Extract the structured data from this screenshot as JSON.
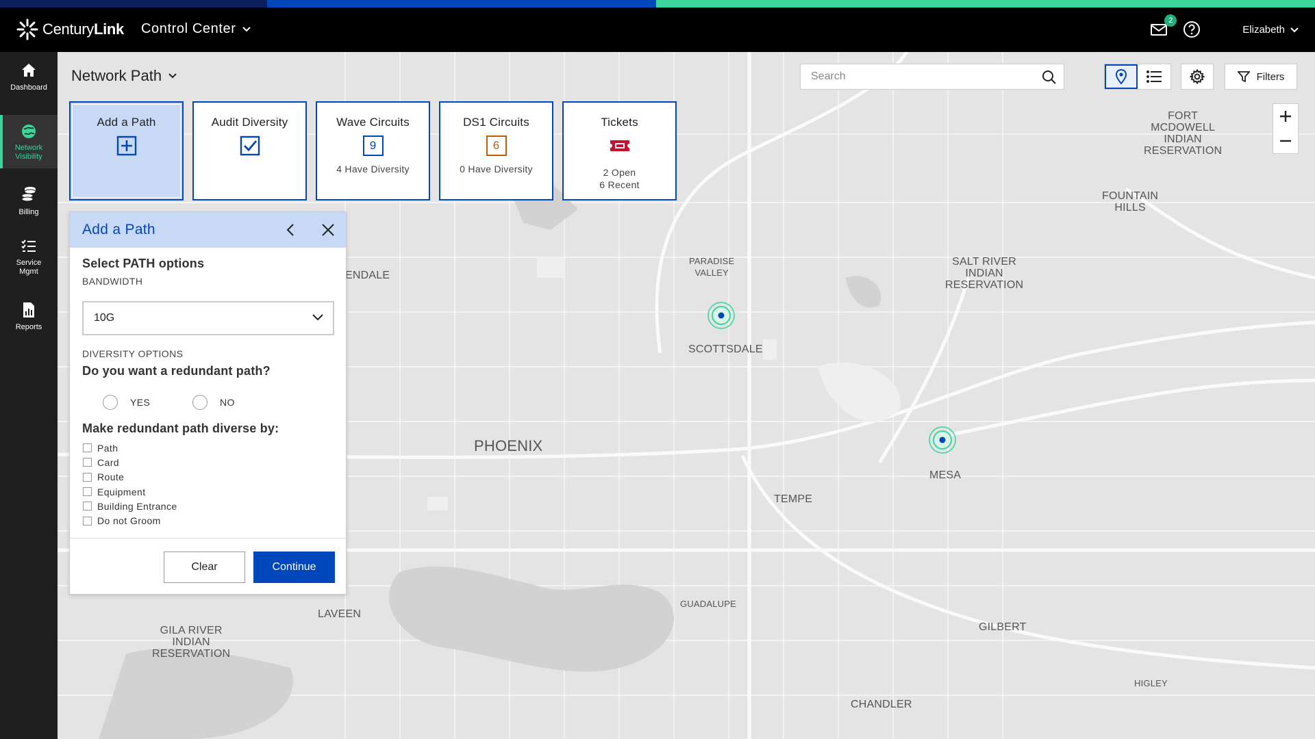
{
  "brand": {
    "name_light": "Century",
    "name_bold": "Link",
    "app_name": "Control Center",
    "accent_colors": [
      "#0b1f5e",
      "#0047bb",
      "#3bd49a"
    ]
  },
  "header": {
    "mail_count": "2",
    "user_name": "Elizabeth"
  },
  "nav": {
    "items": [
      {
        "label": "Dashboard",
        "icon": "home-icon"
      },
      {
        "label": "Network Visibility",
        "icon": "globe-icon",
        "active": true
      },
      {
        "label": "Billing",
        "icon": "coins-icon"
      },
      {
        "label": "Service Mgmt",
        "icon": "checklist-icon"
      },
      {
        "label": "Reports",
        "icon": "report-icon"
      }
    ]
  },
  "page": {
    "title": "Network Path"
  },
  "search": {
    "placeholder": "Search"
  },
  "toolbar": {
    "filters_label": "Filters",
    "map_view_active": true
  },
  "cards": [
    {
      "title": "Add a Path",
      "icon": "plus-box-icon",
      "active": true
    },
    {
      "title": "Audit Diversity",
      "icon": "check-box-icon"
    },
    {
      "title": "Wave Circuits",
      "count": "9",
      "sub": "4 Have Diversity"
    },
    {
      "title": "DS1 Circuits",
      "count": "6",
      "sub": "0 Have Diversity"
    },
    {
      "title": "Tickets",
      "icon": "ticket-icon",
      "sub1": "2 Open",
      "sub2": "6 Recent"
    }
  ],
  "panel": {
    "title": "Add a Path",
    "section_title": "Select PATH options",
    "bandwidth_label": "BANDWIDTH",
    "bandwidth_value": "10G",
    "diversity_label": "DIVERSITY OPTIONS",
    "question": "Do you want a redundant path?",
    "radio_yes": "YES",
    "radio_no": "NO",
    "diverse_by_title": "Make redundant path diverse by:",
    "checkboxes": [
      "Path",
      "Card",
      "Route",
      "Equipment",
      "Building Entrance",
      "Do not Groom"
    ],
    "clear_label": "Clear",
    "continue_label": "Continue"
  },
  "map": {
    "places": {
      "fort_mcdowell": "FORT\nMCDOWELL\nINDIAN\nRESERVATION",
      "fountain_hills": "FOUNTAIN\nHILLS",
      "salt_river": "SALT RIVER\nINDIAN\nRESERVATION",
      "paradise_valley": "PARADISE\nVALLEY",
      "scottsdale": "SCOTTSDALE",
      "glendale_partial": "ENDALE",
      "phoenix": "PHOENIX",
      "mesa": "MESA",
      "tempe": "TEMPE",
      "guadalupe": "GUADALUPE",
      "laveen": "LAVEEN",
      "gila_river": "GILA RIVER\nINDIAN\nRESERVATION",
      "gilbert": "GILBERT",
      "chandler": "CHANDLER",
      "higley": "HIGLEY"
    }
  }
}
